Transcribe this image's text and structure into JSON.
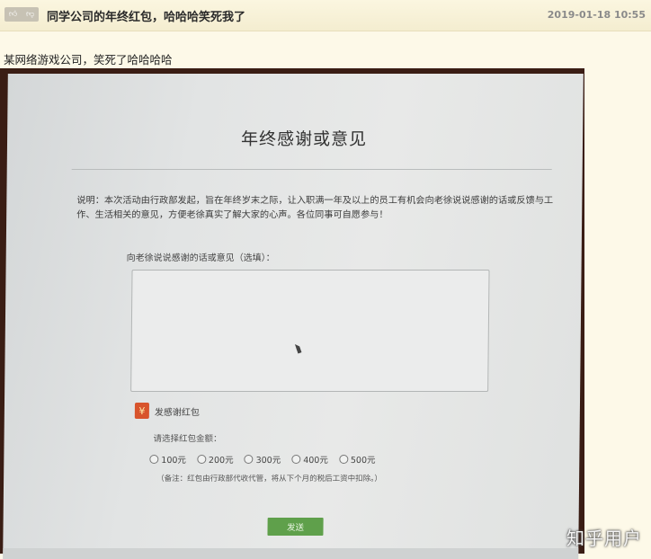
{
  "post": {
    "title": "同学公司的年终红包，哈哈哈笑死我了",
    "date": "2019-01-18 10:55",
    "body": "某网络游戏公司，笑死了哈哈哈哈"
  },
  "vote": {
    "up_icon": "thumbs-up-icon",
    "down_icon": "thumbs-down-icon"
  },
  "form": {
    "title": "年终感谢或意见",
    "description": "说明：本次活动由行政部发起，旨在年终岁末之际，让入职满一年及以上的员工有机会向老徐说说感谢的话或反馈与工作、生活相关的意见，方便老徐真实了解大家的心声。各位同事可自愿参与！",
    "field_label": "向老徐说说感谢的话或意见（选填）：",
    "textarea_value": "",
    "red_packet_label": "发感谢红包",
    "red_packet_icon": "¥",
    "amount_label": "请选择红包金额：",
    "options": [
      "100元",
      "200元",
      "300元",
      "400元",
      "500元"
    ],
    "note": "（备注：红包由行政部代收代管，将从下个月的税后工资中扣除。）",
    "submit_label": "发送"
  },
  "watermark": "知乎用户",
  "colors": {
    "accent": "#5fa04b",
    "red_packet": "#d8542c"
  }
}
